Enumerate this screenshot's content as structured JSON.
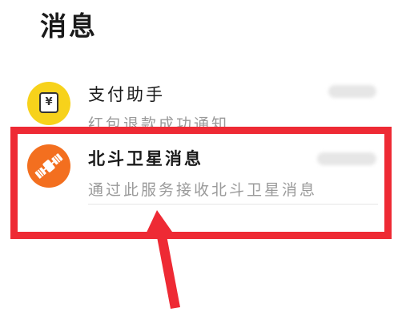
{
  "header": {
    "title": "消息"
  },
  "conversations": [
    {
      "title": "支付助手",
      "preview": "红包退款成功通知",
      "avatar_glyph": "¥",
      "avatar_color": "#f7d21b",
      "icon": "yen-wallet-icon"
    },
    {
      "title": "北斗卫星消息",
      "preview": "通过此服务接收北斗卫星消息",
      "avatar_color": "#f36f1f",
      "icon": "satellite-icon"
    }
  ],
  "annotation": {
    "highlight_color": "#ee2a34"
  }
}
